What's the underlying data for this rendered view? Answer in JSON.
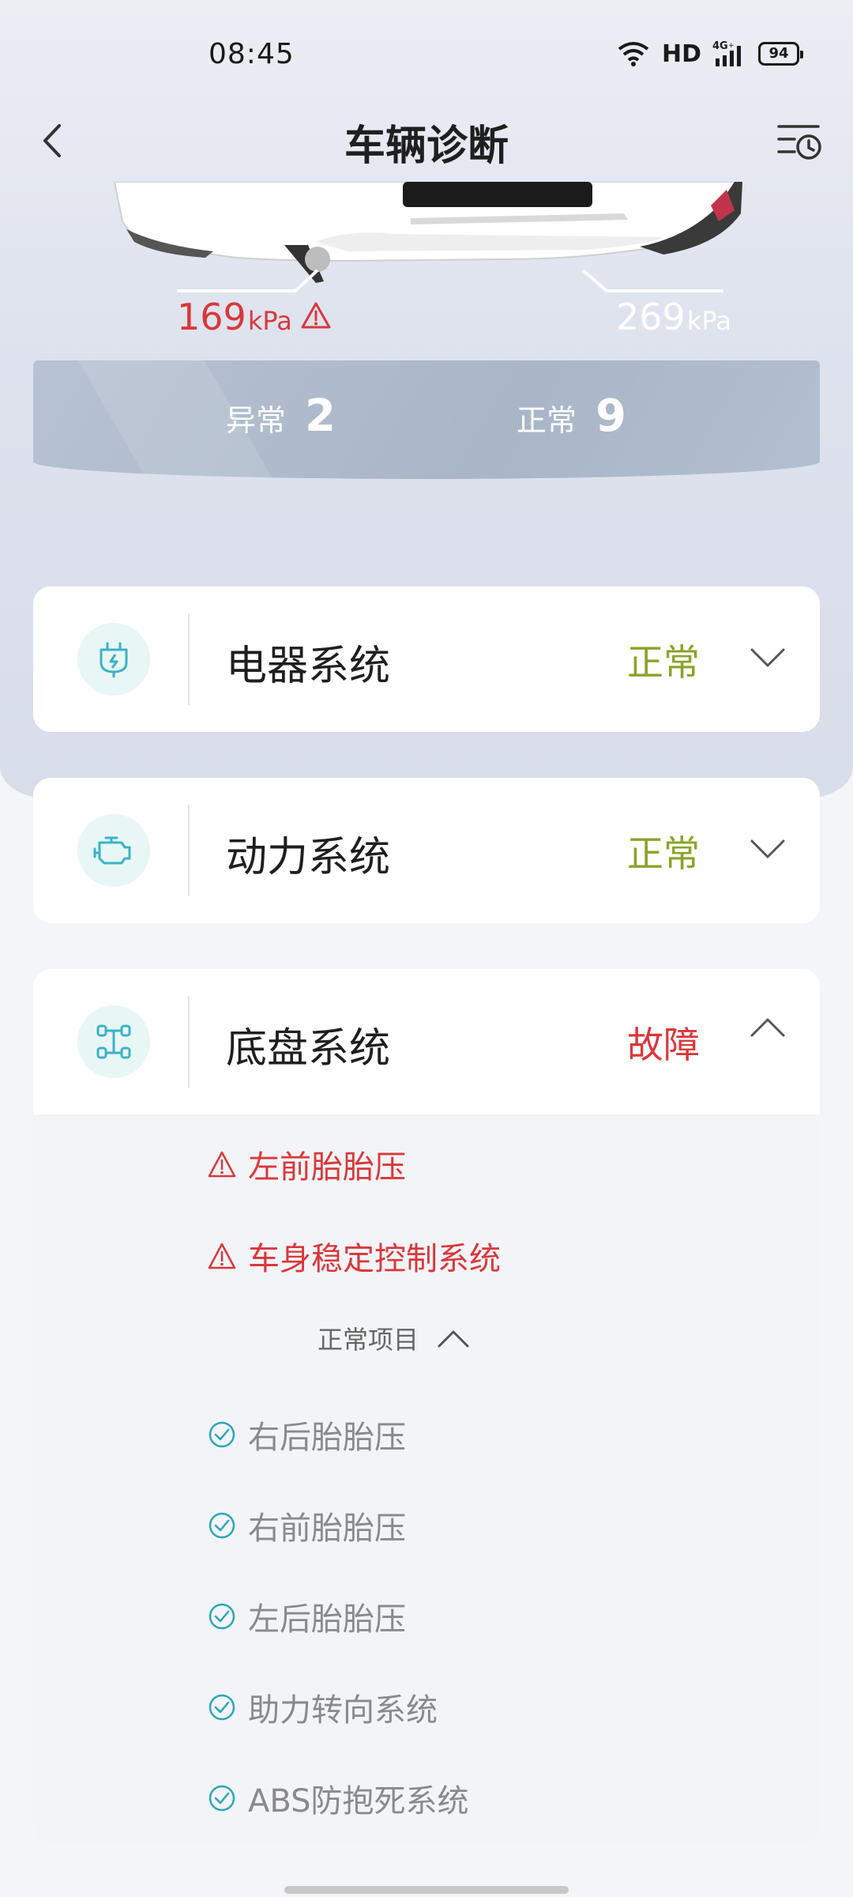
{
  "status_bar": {
    "time": "08:45",
    "network": "HD",
    "signal": "4G",
    "battery": "94"
  },
  "header": {
    "title": "车辆诊断"
  },
  "tires": {
    "left": {
      "value": "169",
      "unit": "kPa",
      "status": "warning"
    },
    "right": {
      "value": "269",
      "unit": "kPa",
      "status": "normal"
    }
  },
  "summary": {
    "abnormal_label": "异常",
    "abnormal_count": "2",
    "normal_label": "正常",
    "normal_count": "9"
  },
  "systems": [
    {
      "name": "电器系统",
      "status": "正常",
      "icon": "battery-plug-icon",
      "expanded": false
    },
    {
      "name": "动力系统",
      "status": "正常",
      "icon": "engine-icon",
      "expanded": false
    },
    {
      "name": "底盘系统",
      "status": "故障",
      "icon": "chassis-axle-icon",
      "expanded": true,
      "faults": [
        "左前胎胎压",
        "车身稳定控制系统"
      ],
      "normal_header": "正常项目",
      "normal_items": [
        "右后胎胎压",
        "右前胎胎压",
        "左后胎胎压",
        "助力转向系统",
        "ABS防抱死系统"
      ]
    }
  ],
  "colors": {
    "ok": "#8aa32a",
    "fault": "#d8383c",
    "icon_teal": "#3bb3c6"
  }
}
